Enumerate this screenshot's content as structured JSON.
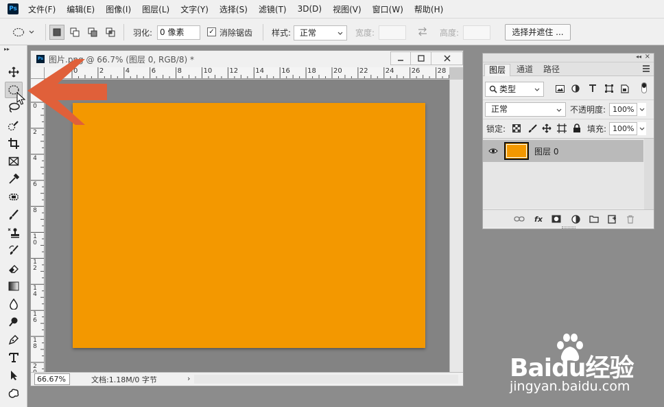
{
  "app": {
    "logo_text": "Ps"
  },
  "menu": [
    "文件(F)",
    "编辑(E)",
    "图像(I)",
    "图层(L)",
    "文字(Y)",
    "选择(S)",
    "滤镜(T)",
    "3D(D)",
    "视图(V)",
    "窗口(W)",
    "帮助(H)"
  ],
  "options": {
    "feather_label": "羽化:",
    "feather_value": "0 像素",
    "antialias_label": "消除锯齿",
    "antialias_checked": true,
    "style_label": "样式:",
    "style_value": "正常",
    "width_label": "宽度:",
    "height_label": "高度:",
    "select_mask_button": "选择并遮住 ..."
  },
  "tools": [
    "move-tool",
    "elliptical-marquee-tool",
    "lasso-tool",
    "quick-selection-tool",
    "crop-tool",
    "frame-tool",
    "eyedropper-tool",
    "spot-healing-tool",
    "brush-tool",
    "clone-stamp-tool",
    "history-brush-tool",
    "eraser-tool",
    "gradient-tool",
    "blur-tool",
    "dodge-tool",
    "pen-tool",
    "type-tool",
    "path-selection-tool",
    "custom-shape-tool"
  ],
  "active_tool": "elliptical-marquee-tool",
  "document": {
    "title": "图片.png @ 66.7% (图层 0, RGB/8) *",
    "ruler_h": [
      "0",
      "2",
      "4",
      "6",
      "8",
      "10",
      "12",
      "14",
      "16",
      "18",
      "20",
      "22",
      "24",
      "26",
      "28"
    ],
    "ruler_v": [
      "0",
      "2",
      "4",
      "6",
      "8",
      "1\n0",
      "1\n2",
      "1\n4",
      "1\n6",
      "1\n8",
      "2\n0"
    ],
    "canvas_color": "#f39800",
    "zoom": "66.67%",
    "doc_info": "文档:1.18M/0 字节"
  },
  "layers_panel": {
    "tabs": [
      "图层",
      "通道",
      "路径"
    ],
    "active_tab": "图层",
    "filter_kind": "类型",
    "blend_mode": "正常",
    "opacity_label": "不透明度:",
    "opacity_value": "100%",
    "lock_label": "锁定:",
    "fill_label": "填充:",
    "fill_value": "100%",
    "layers": [
      {
        "name": "图层 0",
        "visible": true,
        "thumb_color": "#f39800"
      }
    ]
  },
  "watermark": {
    "brand_line": "Baidu经验",
    "url_line": "jingyan.baidu.com"
  },
  "colors": {
    "accent_arrow": "#e0603a",
    "ps_blue": "#31a8ff",
    "ps_dark": "#001e36"
  }
}
